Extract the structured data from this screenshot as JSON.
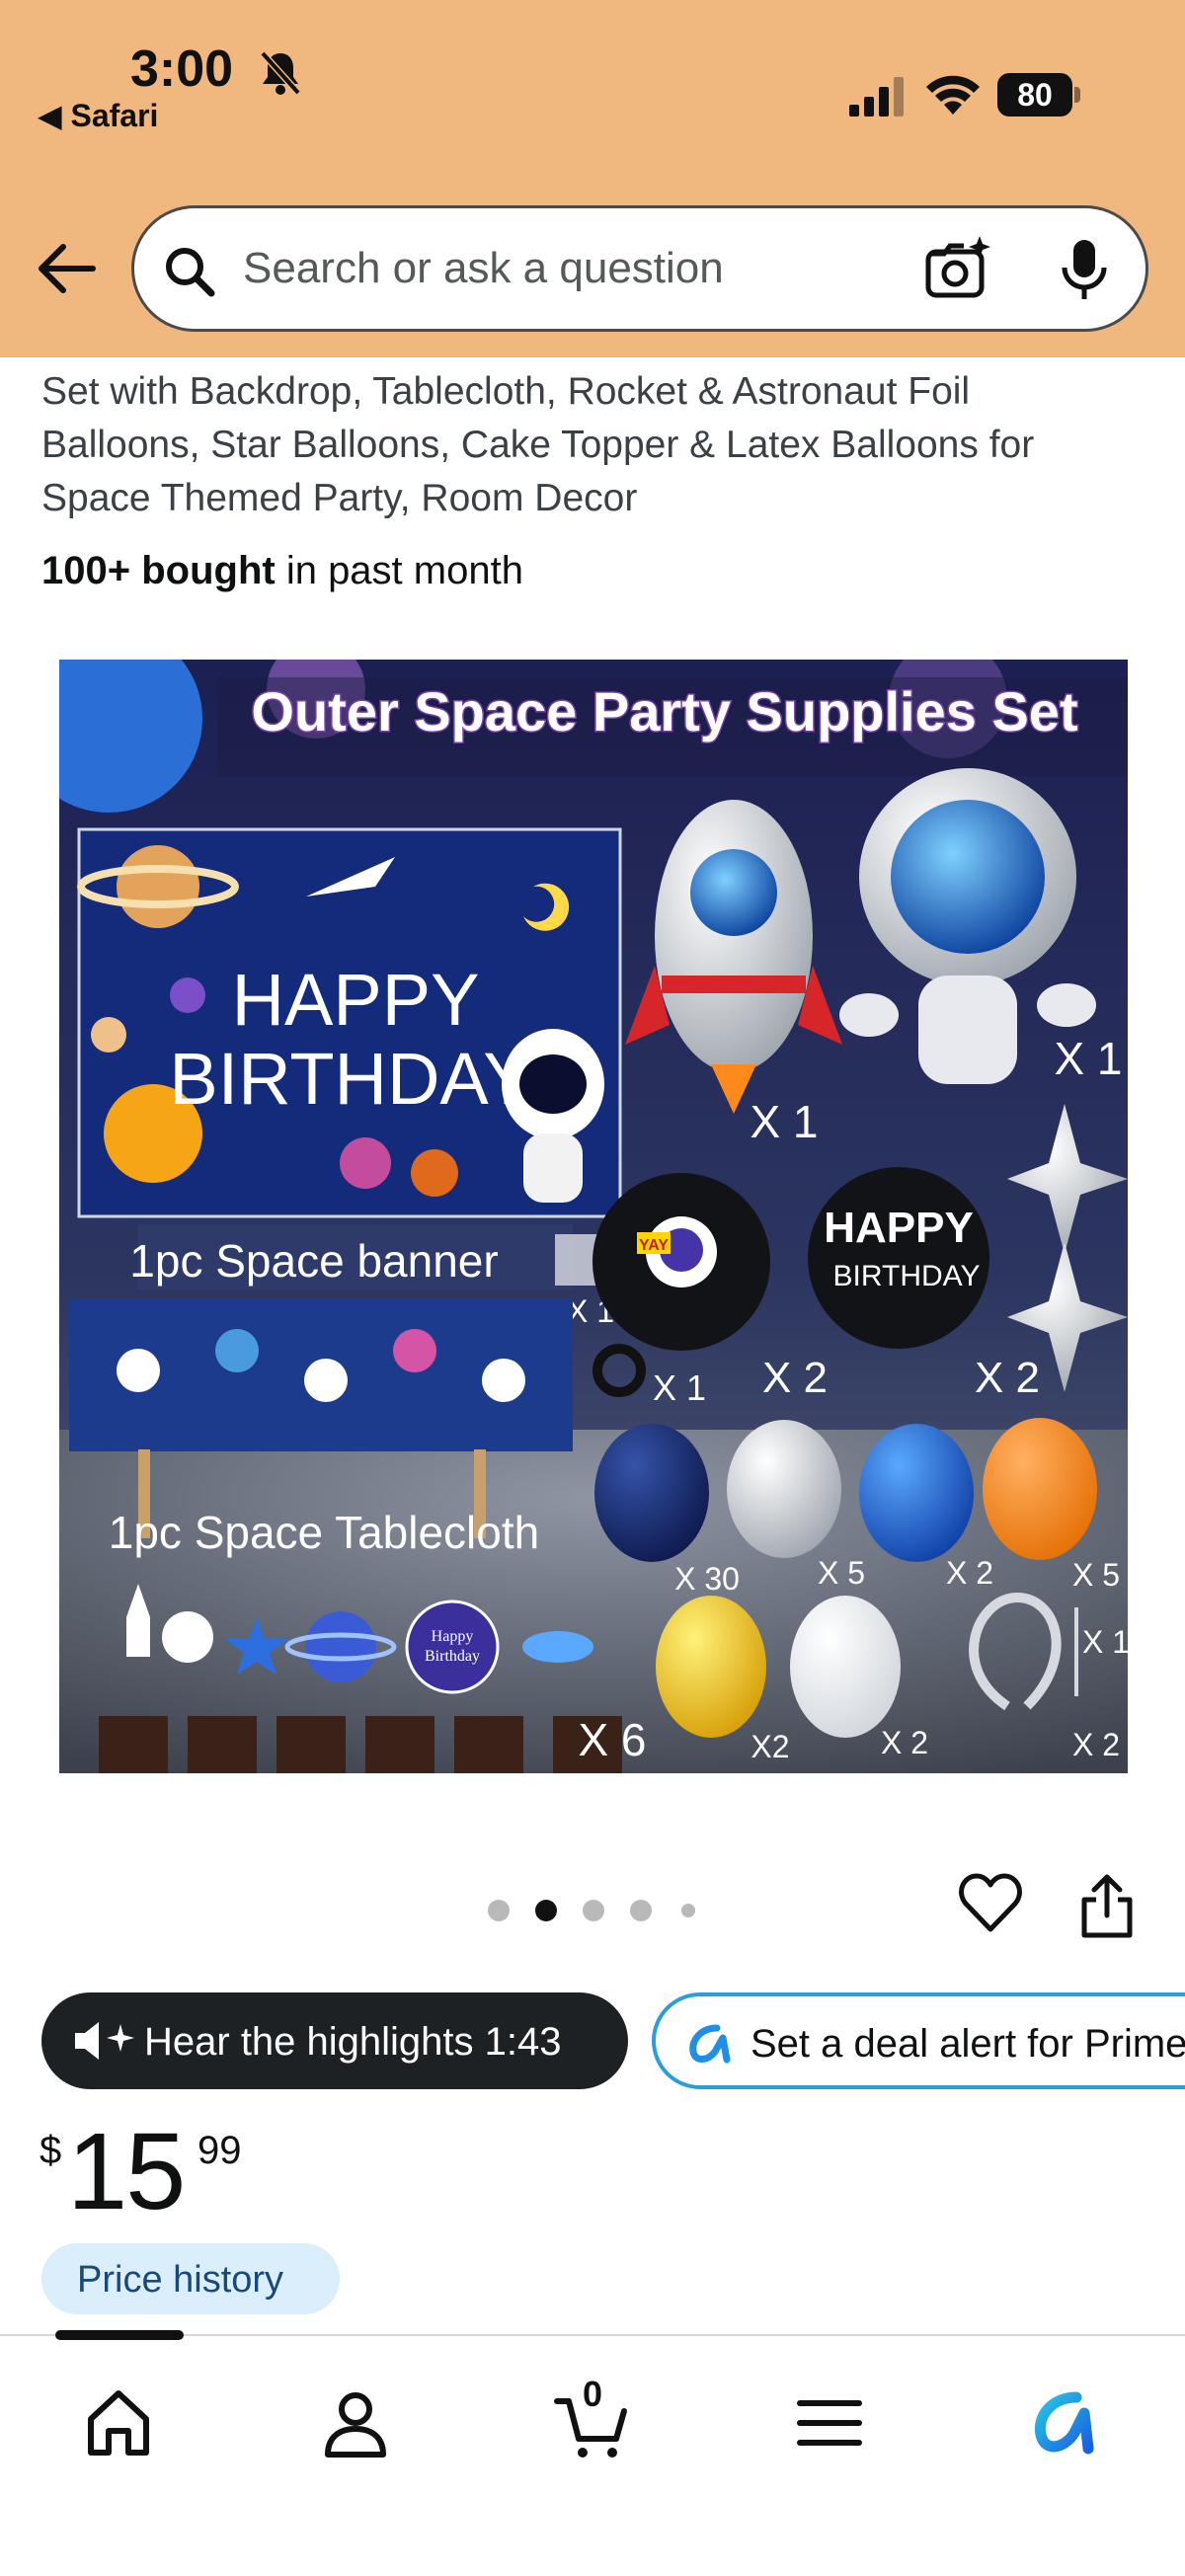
{
  "status_bar": {
    "time": "3:00",
    "back_app": "◀ Safari",
    "battery": "80"
  },
  "search": {
    "placeholder": "Search or ask a question"
  },
  "product": {
    "title_lines": [
      "Set with Backdrop, Tablecloth, Rocket & Astronaut Foil",
      "Balloons, Star Balloons, Cake Topper & Latex Balloons for",
      "Space Themed Party, Room Decor"
    ],
    "bought_bold": "100+ bought",
    "bought_rest": " in past month"
  },
  "image": {
    "banner_title": "Outer Space Party Supplies Set",
    "happy": "HAPPY",
    "birthday": "BIRTHDAY",
    "banner_label": "1pc Space banner",
    "tablecloth_label": "1pc Space Tablecloth",
    "x1_rocket": "X 1",
    "x1_astronaut": "X 1",
    "x1_a": "X 1",
    "x1_b": "X 1",
    "x2_a": "X 2",
    "x2_b": "X 2",
    "x6": "X 6",
    "x30": "X 30",
    "x5_a": "X 5",
    "x2_c": "X 2",
    "x5_b": "X 5",
    "x1_c": "X 1",
    "x2_d": "X2",
    "x2_e": "X 2",
    "x2_f": "X 2",
    "yay": "YAY",
    "foil_happy": "HAPPY",
    "foil_birthday": "BIRTHDAY",
    "topper_happy": "Happy",
    "topper_birthday": "Birthday",
    "carousel_active_index": 1,
    "carousel_count": 5
  },
  "chips": {
    "hear": "Hear the highlights 1:43",
    "deal": "Set a deal alert for Prime"
  },
  "price": {
    "symbol": "$",
    "whole": "15",
    "fraction": "99",
    "history": "Price history"
  },
  "tabbar": {
    "cart_count": "0",
    "items": [
      "home-icon",
      "account-icon",
      "cart-icon",
      "menu-icon",
      "rufus-icon"
    ]
  },
  "colors": {
    "header_bg": "#f0b77f",
    "link_blue": "#2a9fd6",
    "price_history_bg": "#dbeefc"
  }
}
